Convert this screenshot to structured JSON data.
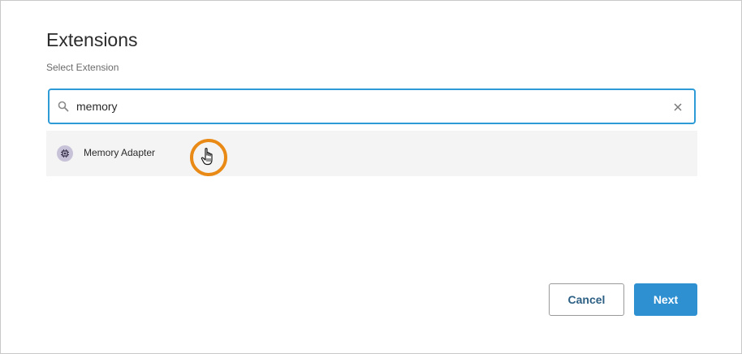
{
  "dialog": {
    "title": "Extensions",
    "subtitle": "Select Extension"
  },
  "search": {
    "value": "memory",
    "icon": "search-icon",
    "clear_icon": "close-icon"
  },
  "results": [
    {
      "label": "Memory Adapter",
      "icon": "chip-icon"
    }
  ],
  "buttons": {
    "cancel_label": "Cancel",
    "next_label": "Next"
  },
  "colors": {
    "accent": "#2e90d1",
    "focus_border": "#2e9bd6",
    "cursor_highlight": "#ea8a16",
    "chip_badge": "#c8c2d8"
  }
}
